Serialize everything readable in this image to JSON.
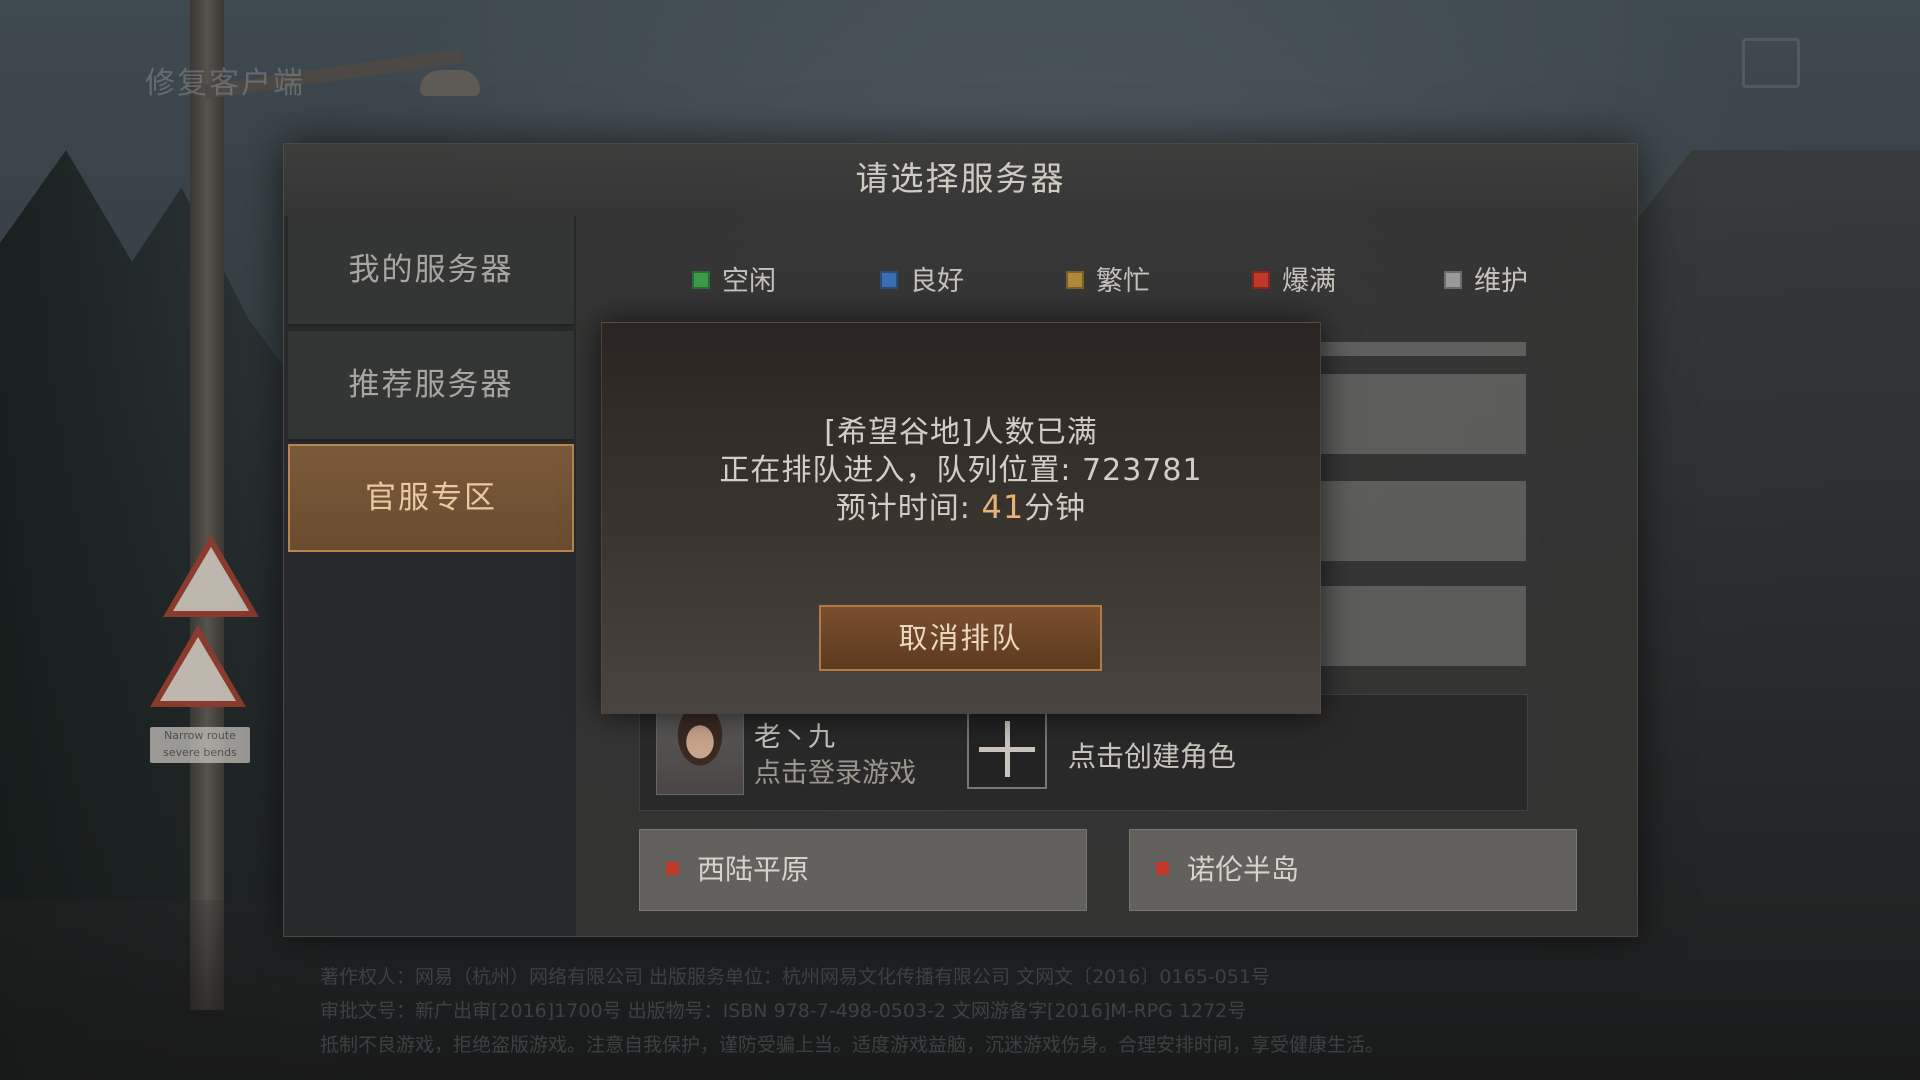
{
  "background": {
    "repair_client": "修复客户端",
    "sign_plate": "Narrow route severe bends",
    "footer_legal": [
      "著作权人：网易（杭州）网络有限公司  出版服务单位：杭州网易文化传播有限公司  文网文〔2016〕0165-051号",
      "审批文号：新广出审[2016]1700号  出版物号：ISBN 978-7-498-0503-2  文网游备字[2016]M-RPG 1272号",
      "抵制不良游戏，拒绝盗版游戏。注意自我保护，谨防受骗上当。适度游戏益脑，沉迷游戏伤身。合理安排时间，享受健康生活。"
    ]
  },
  "panel": {
    "title": "请选择服务器",
    "nav": [
      {
        "label": "我的服务器"
      },
      {
        "label": "推荐服务器"
      },
      {
        "label": "官服专区",
        "selected": true
      }
    ],
    "legend": [
      {
        "label": "空闲",
        "color": "#3d9a4a"
      },
      {
        "label": "良好",
        "color": "#3b6fb0"
      },
      {
        "label": "繁忙",
        "color": "#b08a3a"
      },
      {
        "label": "爆满",
        "color": "#c0392b"
      },
      {
        "label": "维护",
        "color": "#9a9a9a"
      }
    ],
    "character": {
      "name": "老丶九",
      "subtitle": "点击登录游戏",
      "create_label": "点击创建角色"
    },
    "regions": [
      {
        "label": "西陆平原",
        "status_color": "#c0392b"
      },
      {
        "label": "诺伦半岛",
        "status_color": "#c0392b"
      }
    ]
  },
  "dialog": {
    "line1": "[希望谷地]人数已满",
    "line2": "正在排队进入，队列位置: 723781",
    "line3_prefix": "预计时间: ",
    "line3_value": "41",
    "line3_suffix": "分钟",
    "cancel_label": "取消排队"
  }
}
